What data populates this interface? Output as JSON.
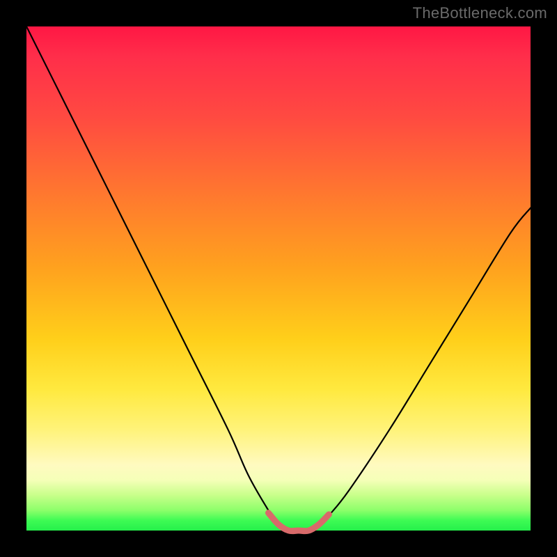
{
  "watermark": "TheBottleneck.com",
  "chart_data": {
    "type": "line",
    "title": "",
    "xlabel": "",
    "ylabel": "",
    "xlim": [
      0,
      100
    ],
    "ylim": [
      0,
      100
    ],
    "series": [
      {
        "name": "bottleneck-curve",
        "x": [
          0,
          8,
          16,
          24,
          32,
          40,
          44,
          48,
          50,
          52,
          54,
          56,
          58,
          60,
          64,
          72,
          80,
          88,
          96,
          100
        ],
        "values": [
          100,
          84,
          68,
          52,
          36,
          20,
          11,
          4,
          1,
          0,
          0,
          0,
          1,
          3,
          8,
          20,
          33,
          46,
          59,
          64
        ]
      },
      {
        "name": "trough-highlight",
        "x": [
          48,
          50,
          52,
          54,
          56,
          58,
          60
        ],
        "values": [
          3.5,
          1.2,
          0,
          0,
          0,
          1.2,
          3.2
        ]
      }
    ],
    "colors": {
      "curve": "#000000",
      "trough": "#d86a6a",
      "gradient_top": "#ff1744",
      "gradient_mid": "#ffcf1a",
      "gradient_bottom": "#25f04b"
    }
  }
}
